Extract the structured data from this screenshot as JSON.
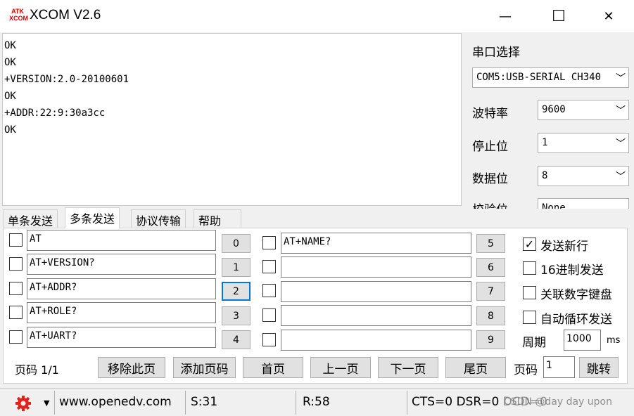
{
  "window": {
    "title": "XCOM V2.6",
    "logo_top": "ATK",
    "logo_bottom": "XCOM",
    "minimize": "—",
    "maximize": "☐",
    "close": "✕"
  },
  "receive_area": {
    "lines": [
      "OK",
      "OK",
      "+VERSION:2.0-20100601",
      "OK",
      "+ADDR:22:9:30a3cc",
      "OK"
    ]
  },
  "settings": {
    "port_label": "串口选择",
    "port_value": "COM5:USB-SERIAL CH340",
    "baud_label": "波特率",
    "baud_value": "9600",
    "stop_label": "停止位",
    "stop_value": "1",
    "data_label": "数据位",
    "data_value": "8",
    "parity_label": "校验位",
    "parity_value": "None",
    "chevron": "﹀"
  },
  "tabs": [
    "单条发送",
    "多条发送",
    "协议传输",
    "帮助"
  ],
  "commands_left": [
    {
      "text": "AT",
      "num": "0"
    },
    {
      "text": "AT+VERSION?",
      "num": "1"
    },
    {
      "text": "AT+ADDR?",
      "num": "2"
    },
    {
      "text": "AT+ROLE?",
      "num": "3"
    },
    {
      "text": "AT+UART?",
      "num": "4"
    }
  ],
  "commands_right": [
    {
      "text": "AT+NAME?",
      "num": "5"
    },
    {
      "text": "",
      "num": "6"
    },
    {
      "text": "",
      "num": "7"
    },
    {
      "text": "",
      "num": "8"
    },
    {
      "text": "",
      "num": "9"
    }
  ],
  "options": {
    "send_newline": {
      "label": "发送新行",
      "checked": true
    },
    "hex_send": {
      "label": "16进制发送",
      "checked": false
    },
    "link_numpad": {
      "label": "关联数字键盘",
      "checked": false
    },
    "auto_loop": {
      "label": "自动循环发送",
      "checked": false
    },
    "period_label": "周期",
    "period_value": "1000",
    "period_unit": "ms"
  },
  "pager": {
    "page_info": "页码 1/1",
    "remove_btn": "移除此页",
    "add_btn": "添加页码",
    "first_btn": "首页",
    "prev_btn": "上一页",
    "next_btn": "下一页",
    "last_btn": "尾页",
    "goto_label": "页码",
    "goto_value": "1",
    "goto_btn": "跳转"
  },
  "statusbar": {
    "website": "www.openedv.com",
    "sent": "S:31",
    "received": "R:58",
    "signals": "CTS=0 DSR=0 DCD=0",
    "watermark": "CSDN @day day upon"
  }
}
